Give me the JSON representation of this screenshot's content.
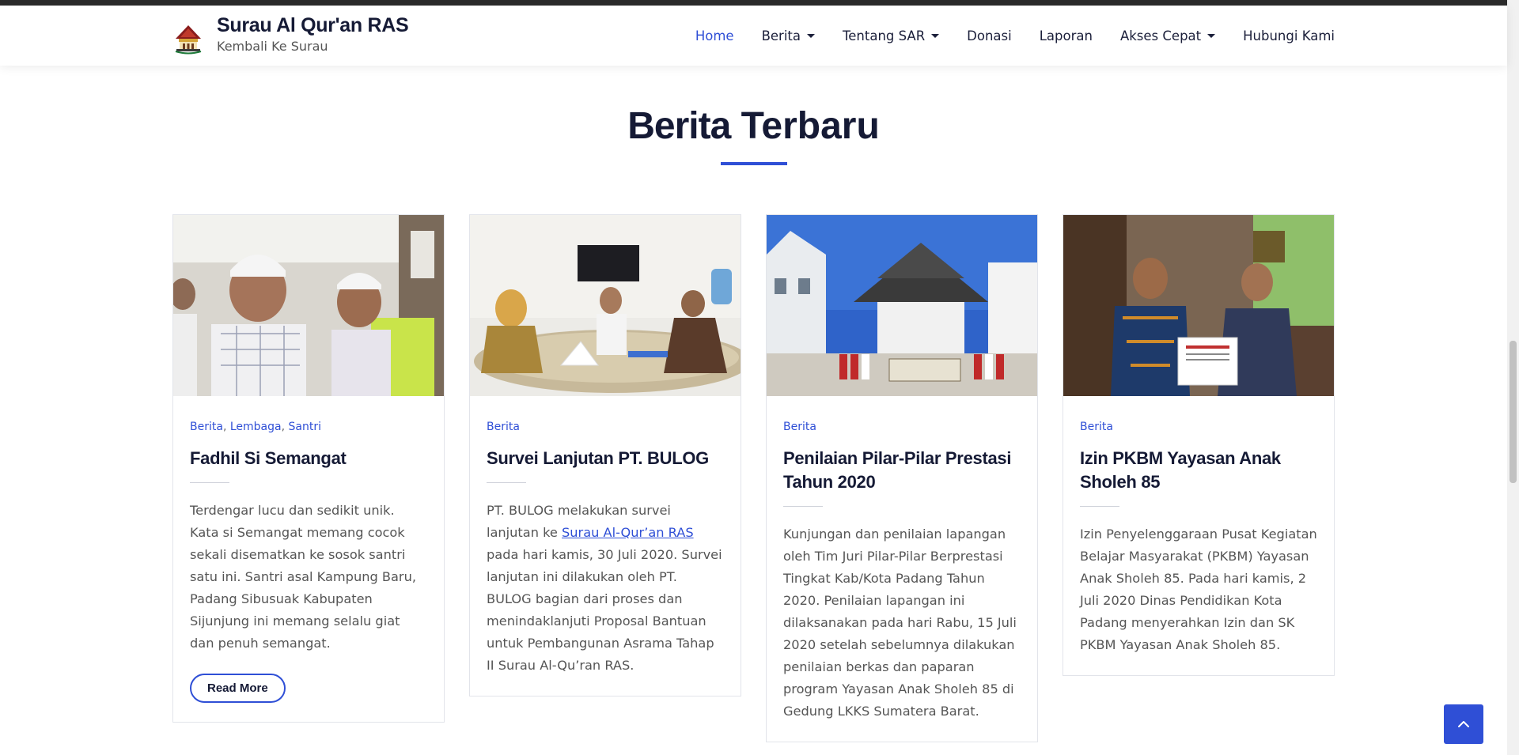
{
  "site": {
    "title": "Surau Al Qur'an RAS",
    "tagline": "Kembali Ke Surau",
    "logo_icon": "mosque-logo-icon"
  },
  "nav": {
    "items": [
      {
        "label": "Home",
        "active": true,
        "dropdown": false
      },
      {
        "label": "Berita",
        "active": false,
        "dropdown": true
      },
      {
        "label": "Tentang SAR",
        "active": false,
        "dropdown": true
      },
      {
        "label": "Donasi",
        "active": false,
        "dropdown": false
      },
      {
        "label": "Laporan",
        "active": false,
        "dropdown": false
      },
      {
        "label": "Akses Cepat",
        "active": false,
        "dropdown": true
      },
      {
        "label": "Hubungi Kami",
        "active": false,
        "dropdown": false
      }
    ]
  },
  "section": {
    "title_bold": "Berita",
    "title_rest": "Terbaru"
  },
  "posts": [
    {
      "categories": [
        "Berita",
        "Lembaga",
        "Santri"
      ],
      "title": "Fadhil Si Semangat",
      "excerpt": "Terdengar lucu dan sedikit unik. Kata si Semangat memang cocok sekali disematkan ke sosok santri satu ini. Santri asal Kampung Baru, Padang Sibusuak Kabupaten Sijunjung ini memang selalu giat dan penuh semangat.",
      "read_more": "Read More"
    },
    {
      "categories": [
        "Berita"
      ],
      "title": "Survei Lanjutan PT. BULOG",
      "excerpt_before": "PT. BULOG melakukan survei lanjutan ke ",
      "excerpt_link": "Surau Al-Qur’an RAS",
      "excerpt_after": " pada hari kamis, 30 Juli 2020. Survei lanjutan ini dilakukan oleh PT. BULOG bagian dari proses dan menindaklanjuti Proposal Bantuan untuk Pembangunan Asrama Tahap II Surau Al-Qu’ran RAS."
    },
    {
      "categories": [
        "Berita"
      ],
      "title": "Penilaian Pilar-Pilar Prestasi Tahun 2020",
      "excerpt": "Kunjungan dan penilaian lapangan oleh Tim Juri Pilar-Pilar Berprestasi Tingkat Kab/Kota Padang Tahun 2020. Penilaian lapangan ini dilaksanakan pada hari Rabu, 15 Juli 2020 setelah sebelumnya dilakukan penilaian berkas dan paparan program Yayasan Anak Sholeh 85 di Gedung LKKS Sumatera Barat."
    },
    {
      "categories": [
        "Berita"
      ],
      "title": "Izin PKBM Yayasan Anak Sholeh 85",
      "excerpt": "Izin Penyelenggaraan Pusat Kegiatan Belajar Masyarakat (PKBM) Yayasan Anak Sholeh 85. Pada hari kamis, 2 Juli 2020 Dinas Pendidikan Kota Padang menyerahkan Izin dan SK PKBM Yayasan Anak Sholeh 85."
    }
  ],
  "colors": {
    "accent": "#2f4fd6",
    "heading": "#151a35",
    "body_text": "#555555"
  },
  "scroll_top_icon": "chevron-up-icon"
}
